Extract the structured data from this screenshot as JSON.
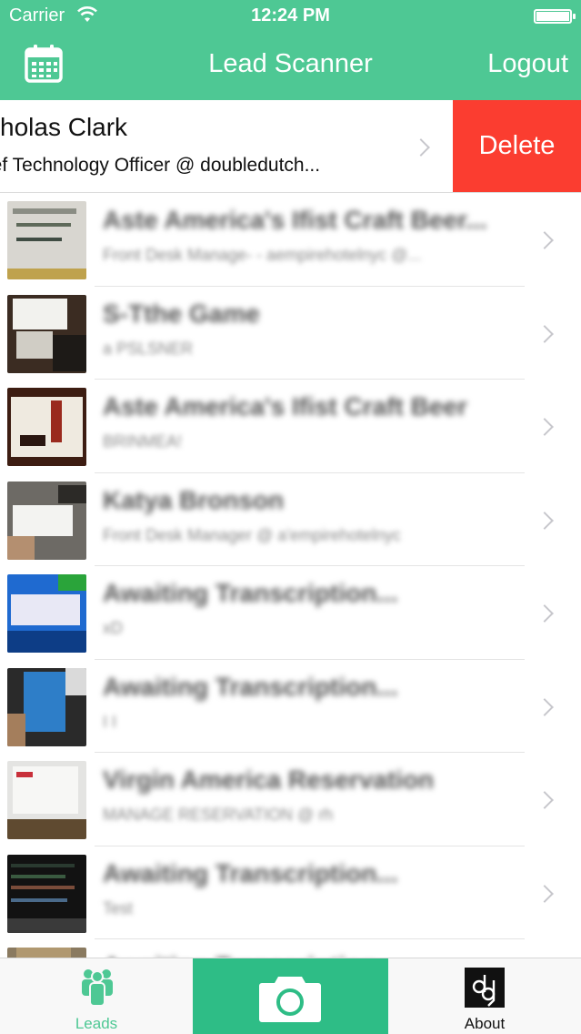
{
  "status_bar": {
    "carrier": "Carrier",
    "time": "12:24 PM"
  },
  "nav": {
    "title": "Lead Scanner",
    "logout_label": "Logout",
    "left_icon": "calendar-icon"
  },
  "swiped_lead": {
    "name": "cholas Clark",
    "subtitle": "ief Technology Officer @ doubledutch...",
    "delete_label": "Delete"
  },
  "leads": [
    {
      "title": "Aste America's Ifist Craft Beer...",
      "subtitle": "Front Desk Manage- - aempirehotelnyc @...",
      "thumb": "screen"
    },
    {
      "title": "S-Tthe Game",
      "subtitle": "a PSLSNER",
      "thumb": "beer"
    },
    {
      "title": "Aste America's Ifist Craft Beer",
      "subtitle": "BRINMEA!",
      "thumb": "coaster"
    },
    {
      "title": "Katya Bronson",
      "subtitle": "Front Desk Manager @ a'empirehotelnyc",
      "thumb": "card"
    },
    {
      "title": "Awaiting Transcription...",
      "subtitle": "xD",
      "thumb": "box"
    },
    {
      "title": "Awaiting Transcription...",
      "subtitle": "I I",
      "thumb": "creditcard"
    },
    {
      "title": "Virgin America Reservation",
      "subtitle": "MANAGE RESERVATION @ rh",
      "thumb": "laptop"
    },
    {
      "title": "Awaiting Transcription...",
      "subtitle": "Test",
      "thumb": "terminal"
    },
    {
      "title": "Awaiting Transcription...",
      "subtitle": "",
      "thumb": "partial"
    }
  ],
  "tabbar": {
    "leads_label": "Leads",
    "about_label": "About",
    "leads_icon": "people-icon",
    "camera_icon": "camera-icon",
    "about_icon": "doubledutch-logo-icon"
  },
  "colors": {
    "brand": "#4ec894",
    "camera_tab": "#2ebd86",
    "delete": "#fb3d30"
  }
}
